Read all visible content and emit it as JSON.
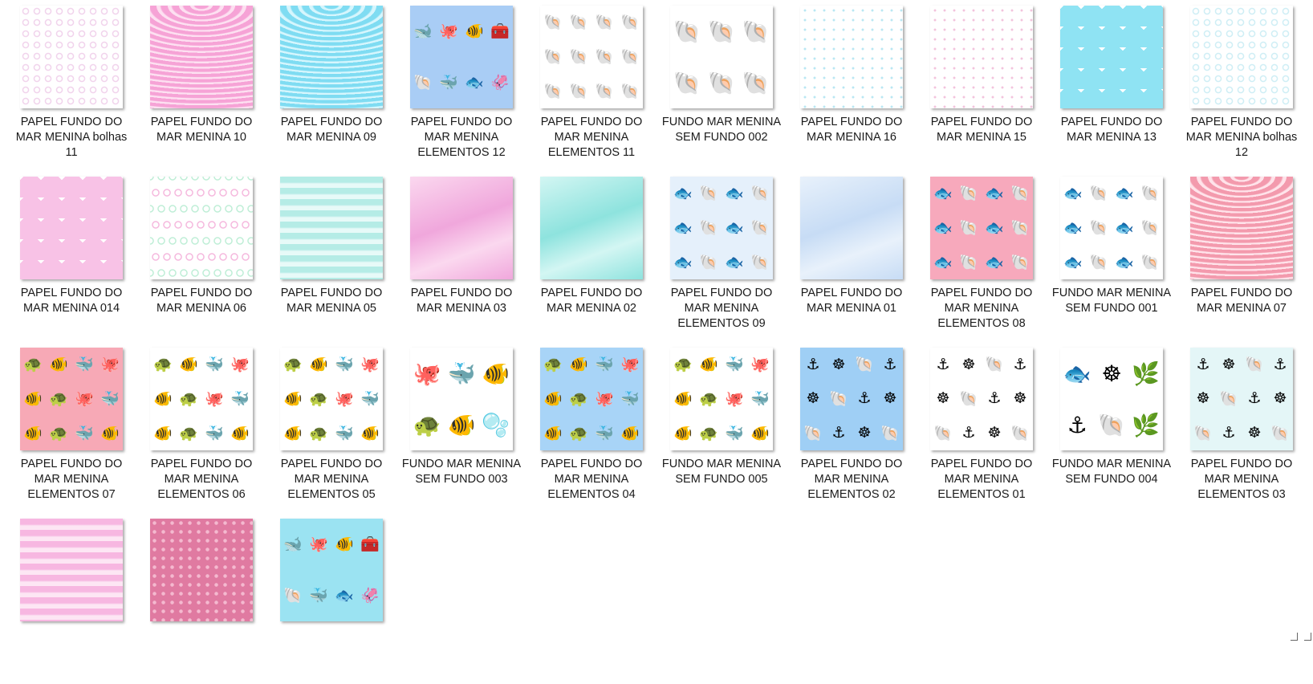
{
  "files": [
    {
      "name": "PAPEL FUNDO DO MAR MENINA bolhas 11",
      "pattern": "bubbles",
      "colors": [
        "#ffffff",
        "#f1d3ec"
      ]
    },
    {
      "name": "PAPEL FUNDO DO MAR MENINA 10",
      "pattern": "waves",
      "colors": [
        "#f6a3d6",
        "#fde0f1"
      ]
    },
    {
      "name": "PAPEL FUNDO DO MAR MENINA 09",
      "pattern": "waves",
      "colors": [
        "#7fdcf2",
        "#d6f6fd"
      ]
    },
    {
      "name": "PAPEL FUNDO DO MAR MENINA ELEMENTOS 12",
      "pattern": "elements",
      "colors": [
        "#a9cdf5",
        "#f3a6cf",
        "#7ed3e8"
      ]
    },
    {
      "name": "PAPEL FUNDO DO MAR MENINA ELEMENTOS 11",
      "pattern": "shells",
      "colors": [
        "#ffffff",
        "#f2b4c9",
        "#f0c08a"
      ]
    },
    {
      "name": "FUNDO MAR MENINA SEM FUNDO 002",
      "pattern": "shells-large",
      "colors": [
        "#ffffff",
        "#f3a3bf",
        "#efb36a"
      ]
    },
    {
      "name": "PAPEL FUNDO DO MAR MENINA 16",
      "pattern": "dots",
      "colors": [
        "#ffffff",
        "#b9e7f3"
      ]
    },
    {
      "name": "PAPEL FUNDO DO MAR MENINA 15",
      "pattern": "dots",
      "colors": [
        "#ffffff",
        "#f3c3dd"
      ]
    },
    {
      "name": "PAPEL FUNDO DO MAR MENINA 13",
      "pattern": "chevron",
      "colors": [
        "#8fe3f3",
        "#ffffff"
      ]
    },
    {
      "name": "PAPEL FUNDO DO MAR MENINA bolhas 12",
      "pattern": "bubbles",
      "colors": [
        "#ffffff",
        "#cfeef5"
      ]
    },
    {
      "name": "PAPEL FUNDO DO MAR MENINA 014",
      "pattern": "chevron",
      "colors": [
        "#f8c2e6",
        "#ffffff"
      ]
    },
    {
      "name": "PAPEL FUNDO DO MAR MENINA 06",
      "pattern": "bubble-waves",
      "colors": [
        "#ffffff",
        "#f5b9de",
        "#bfeed7"
      ]
    },
    {
      "name": "PAPEL FUNDO DO MAR MENINA 05",
      "pattern": "stripes",
      "colors": [
        "#b5ece6",
        "#e7faf8"
      ]
    },
    {
      "name": "PAPEL FUNDO DO MAR MENINA 03",
      "pattern": "watercolor",
      "colors": [
        "#f0a7dc",
        "#fbd8ef"
      ]
    },
    {
      "name": "PAPEL FUNDO DO MAR MENINA 02",
      "pattern": "watercolor",
      "colors": [
        "#8ee3de",
        "#d3f6f3"
      ]
    },
    {
      "name": "PAPEL FUNDO DO MAR MENINA ELEMENTOS 09",
      "pattern": "fish",
      "colors": [
        "#e5f0fb",
        "#f3a6cf",
        "#6fd0e3"
      ]
    },
    {
      "name": "PAPEL FUNDO DO MAR MENINA 01",
      "pattern": "watercolor",
      "colors": [
        "#c7dcf5",
        "#e8f1fb"
      ]
    },
    {
      "name": "PAPEL FUNDO DO MAR MENINA ELEMENTOS 08",
      "pattern": "fish",
      "colors": [
        "#f7a9bc",
        "#ffffff",
        "#76cfe0"
      ]
    },
    {
      "name": "FUNDO MAR MENINA SEM FUNDO 001",
      "pattern": "fish",
      "colors": [
        "#ffffff",
        "#f3a6cf",
        "#66c9d9"
      ]
    },
    {
      "name": "PAPEL FUNDO DO MAR MENINA 07",
      "pattern": "waves",
      "colors": [
        "#f39aad",
        "#ffe3ea"
      ]
    },
    {
      "name": "PAPEL FUNDO DO MAR MENINA ELEMENTOS 07",
      "pattern": "ocean",
      "colors": [
        "#f7a9b6",
        "#6fcbe0",
        "#f26a35"
      ]
    },
    {
      "name": "PAPEL FUNDO DO MAR MENINA ELEMENTOS 06",
      "pattern": "ocean",
      "colors": [
        "#ffffff",
        "#6fcbe0",
        "#f26a35"
      ]
    },
    {
      "name": "PAPEL FUNDO DO MAR MENINA ELEMENTOS 05",
      "pattern": "ocean",
      "colors": [
        "#ffffff",
        "#e8a2d6",
        "#f26a35"
      ]
    },
    {
      "name": "FUNDO MAR MENINA SEM FUNDO 003",
      "pattern": "ocean-large",
      "colors": [
        "#ffffff",
        "#5fb9cf",
        "#f26a35"
      ]
    },
    {
      "name": "PAPEL FUNDO DO MAR MENINA ELEMENTOS 04",
      "pattern": "ocean",
      "colors": [
        "#a8d4f7",
        "#e8a2d6",
        "#f26a35"
      ]
    },
    {
      "name": "FUNDO MAR MENINA SEM FUNDO 005",
      "pattern": "ocean",
      "colors": [
        "#ffffff",
        "#e8a2d6",
        "#f26a35"
      ]
    },
    {
      "name": "PAPEL FUNDO DO MAR MENINA ELEMENTOS 02",
      "pattern": "nautical",
      "colors": [
        "#9fcff5",
        "#8a5a3a",
        "#f07aa6"
      ]
    },
    {
      "name": "PAPEL FUNDO DO MAR MENINA ELEMENTOS 01",
      "pattern": "nautical",
      "colors": [
        "#ffffff",
        "#8a5a3a",
        "#f07aa6"
      ]
    },
    {
      "name": "FUNDO MAR MENINA SEM FUNDO 004",
      "pattern": "nautical-large",
      "colors": [
        "#ffffff",
        "#8a5a3a",
        "#f07aa6"
      ]
    },
    {
      "name": "PAPEL FUNDO DO MAR MENINA ELEMENTOS 03",
      "pattern": "nautical",
      "colors": [
        "#e4f6f7",
        "#8a5a3a",
        "#f07aa6"
      ]
    },
    {
      "name": "",
      "pattern": "stripes",
      "colors": [
        "#f7b7e1",
        "#fde6f4"
      ]
    },
    {
      "name": "",
      "pattern": "polka",
      "colors": [
        "#e07aa1",
        "#f4b9cf"
      ]
    },
    {
      "name": "",
      "pattern": "elements",
      "colors": [
        "#9be3f2",
        "#f3a6cf",
        "#7ed3e8"
      ]
    }
  ]
}
